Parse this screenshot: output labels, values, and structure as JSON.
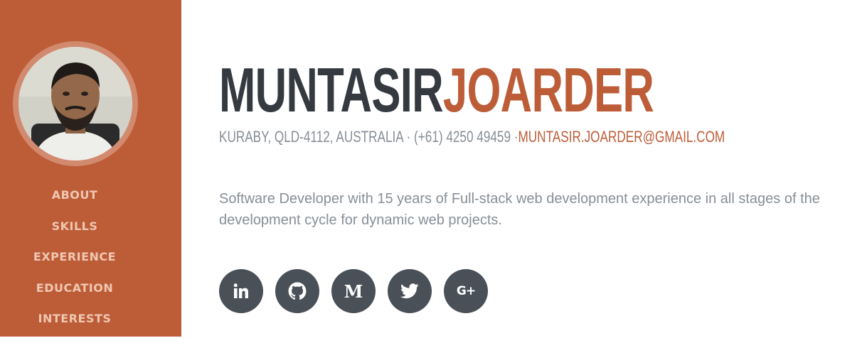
{
  "profile": {
    "photo_alt": "profile photo"
  },
  "nav": {
    "items": [
      {
        "label": "ABOUT"
      },
      {
        "label": "SKILLS"
      },
      {
        "label": "EXPERIENCE"
      },
      {
        "label": "EDUCATION"
      },
      {
        "label": "INTERESTS"
      }
    ]
  },
  "header": {
    "first_name": "MUNTASIR",
    "last_name": "JOARDER"
  },
  "contact": {
    "address": "KURABY, QLD-4112, AUSTRALIA · (+61) 4250 49459 ·",
    "email": "MUNTASIR.JOARDER@GMAIL.COM"
  },
  "summary": "Software Developer with 15 years of Full-stack web development experience in all stages of the development cycle for dynamic web projects.",
  "socials": [
    {
      "icon": "linkedin-icon"
    },
    {
      "icon": "github-icon"
    },
    {
      "icon": "medium-icon",
      "glyph": "M"
    },
    {
      "icon": "twitter-icon"
    },
    {
      "icon": "google-plus-icon",
      "glyph": "G+"
    }
  ],
  "colors": {
    "sidebar": "#bd5d38",
    "accent": "#bd5d38",
    "heading": "#343a40",
    "muted": "#868e96",
    "social_bg": "#495057"
  }
}
